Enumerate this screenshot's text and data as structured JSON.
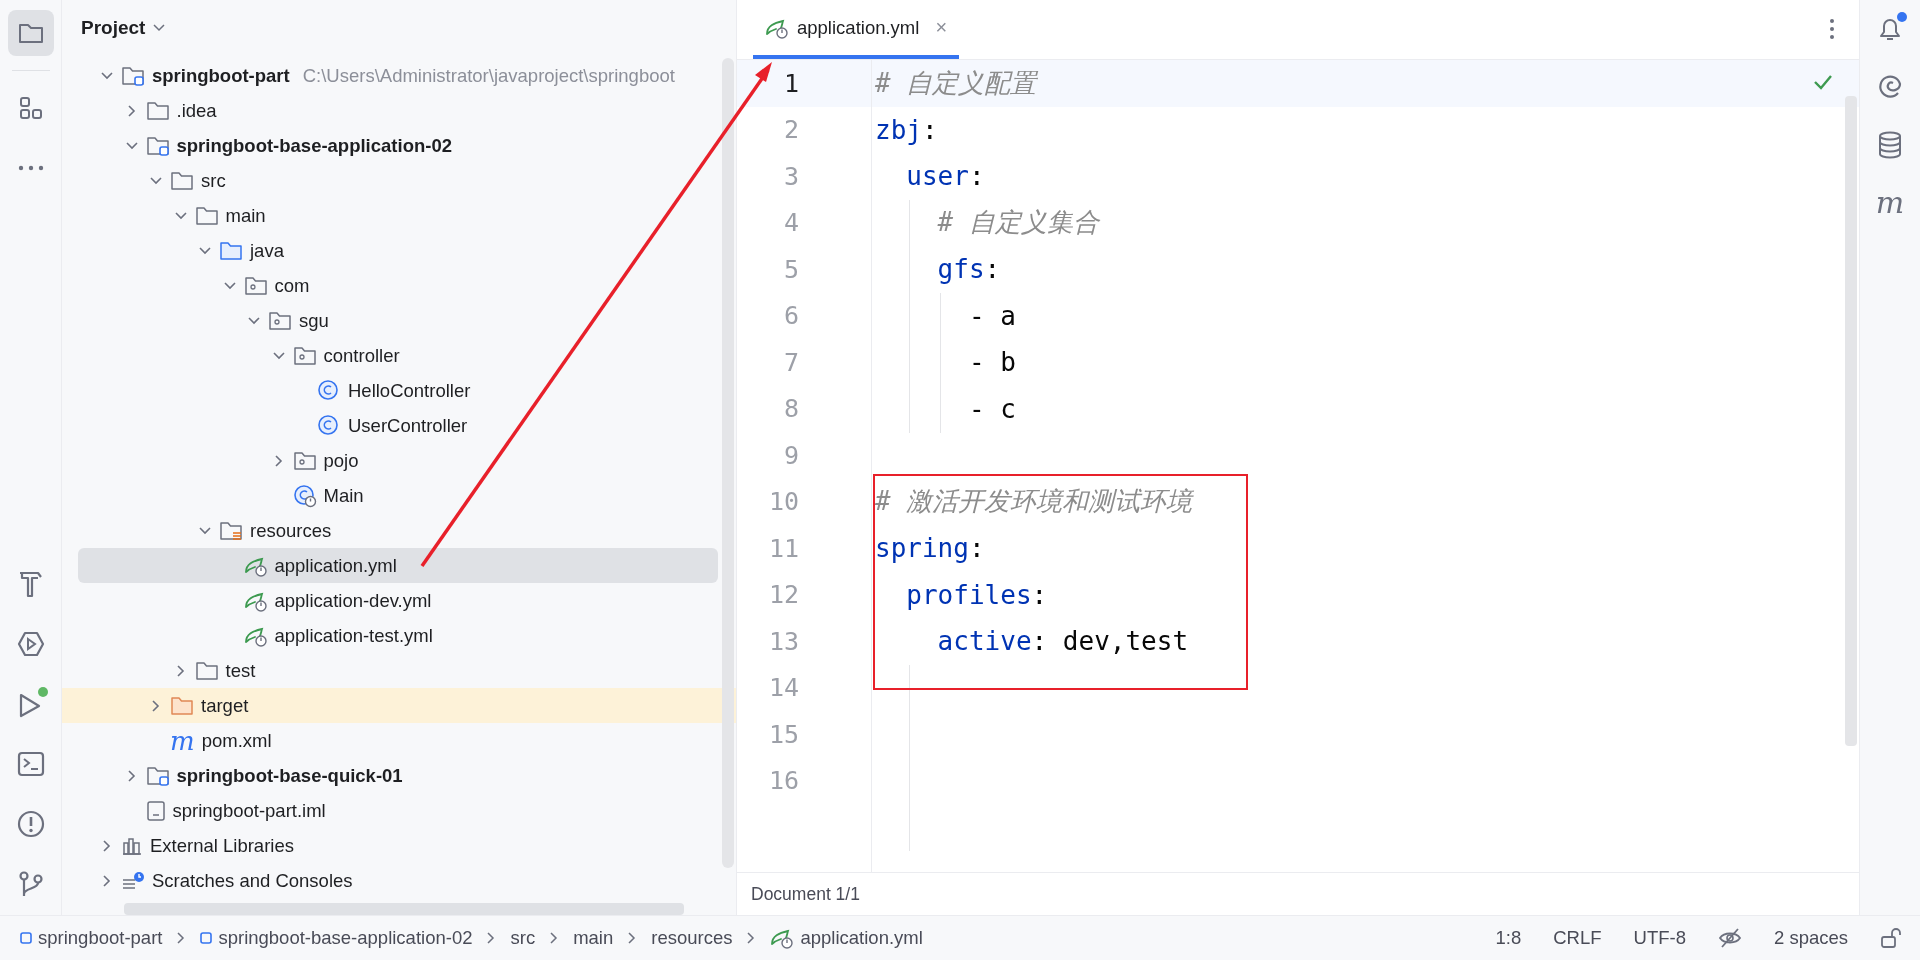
{
  "left_toolbar": {
    "top": [
      {
        "kind": "project",
        "selected": true
      },
      {
        "kind": "structure",
        "selected": false
      },
      {
        "kind": "more",
        "selected": false
      }
    ],
    "bottom": [
      {
        "kind": "build",
        "badge": false
      },
      {
        "kind": "services",
        "badge": false
      },
      {
        "kind": "run",
        "badge": true
      },
      {
        "kind": "terminal",
        "badge": false
      },
      {
        "kind": "problems",
        "badge": false
      },
      {
        "kind": "git",
        "badge": false
      }
    ]
  },
  "project": {
    "title": "Project",
    "tree": [
      {
        "name": "springboot-part",
        "kind": "module",
        "path": "C:\\Users\\Administrator\\javaproject\\springboot",
        "expanded": true,
        "selected": false,
        "children": [
          {
            "name": ".idea",
            "kind": "folder",
            "expanded": false,
            "selected": false
          },
          {
            "name": "springboot-base-application-02",
            "kind": "module",
            "expanded": true,
            "selected": false,
            "children": [
              {
                "name": "src",
                "kind": "folder",
                "expanded": true,
                "selected": false,
                "children": [
                  {
                    "name": "main",
                    "kind": "folder",
                    "expanded": true,
                    "selected": false,
                    "children": [
                      {
                        "name": "java",
                        "kind": "source-folder",
                        "expanded": true,
                        "selected": false,
                        "children": [
                          {
                            "name": "com",
                            "kind": "package",
                            "expanded": true,
                            "selected": false,
                            "children": [
                              {
                                "name": "sgu",
                                "kind": "package",
                                "expanded": true,
                                "selected": false,
                                "children": [
                                  {
                                    "name": "controller",
                                    "kind": "package",
                                    "expanded": true,
                                    "selected": false,
                                    "children": [
                                      {
                                        "name": "HelloController",
                                        "kind": "class",
                                        "selected": false
                                      },
                                      {
                                        "name": "UserController",
                                        "kind": "class",
                                        "selected": false
                                      }
                                    ]
                                  },
                                  {
                                    "name": "pojo",
                                    "kind": "package",
                                    "expanded": false,
                                    "selected": false
                                  },
                                  {
                                    "name": "Main",
                                    "kind": "main-class",
                                    "selected": false
                                  }
                                ]
                              }
                            ]
                          }
                        ]
                      },
                      {
                        "name": "resources",
                        "kind": "resource-folder",
                        "expanded": true,
                        "selected": false,
                        "children": [
                          {
                            "name": "application.yml",
                            "kind": "yml",
                            "selected": true
                          },
                          {
                            "name": "application-dev.yml",
                            "kind": "yml",
                            "selected": false
                          },
                          {
                            "name": "application-test.yml",
                            "kind": "yml",
                            "selected": false
                          }
                        ]
                      }
                    ]
                  },
                  {
                    "name": "test",
                    "kind": "folder",
                    "expanded": false,
                    "selected": false
                  }
                ]
              },
              {
                "name": "target",
                "kind": "excluded-folder",
                "expanded": false,
                "selected": false
              },
              {
                "name": "pom.xml",
                "kind": "maven",
                "glyph": "m",
                "selected": false
              }
            ]
          },
          {
            "name": "springboot-base-quick-01",
            "kind": "module",
            "expanded": false,
            "selected": false
          },
          {
            "name": "springboot-part.iml",
            "kind": "iml",
            "selected": false
          }
        ]
      },
      {
        "name": "External Libraries",
        "kind": "libraries",
        "expanded": false,
        "selected": false
      },
      {
        "name": "Scratches and Consoles",
        "kind": "scratches",
        "expanded": false,
        "selected": false
      }
    ]
  },
  "editor": {
    "tabs": [
      {
        "label": "application.yml",
        "close": "×",
        "selected": true
      }
    ],
    "lines": [
      {
        "number": "1",
        "current": true,
        "tokens": [
          {
            "kind": "comment",
            "text": "# 自定义配置"
          }
        ]
      },
      {
        "number": "2",
        "current": false,
        "tokens": [
          {
            "kind": "key",
            "text": "zbj"
          },
          {
            "kind": "plain",
            "text": ":"
          }
        ]
      },
      {
        "number": "3",
        "current": false,
        "tokens": [
          {
            "kind": "key",
            "text": "  user"
          },
          {
            "kind": "plain",
            "text": ":"
          }
        ]
      },
      {
        "number": "4",
        "current": false,
        "tokens": [
          {
            "kind": "comment",
            "text": "    # 自定义集合"
          }
        ]
      },
      {
        "number": "5",
        "current": false,
        "tokens": [
          {
            "kind": "key",
            "text": "    gfs"
          },
          {
            "kind": "plain",
            "text": ":"
          }
        ]
      },
      {
        "number": "6",
        "current": false,
        "tokens": [
          {
            "kind": "plain",
            "text": "      - a"
          }
        ]
      },
      {
        "number": "7",
        "current": false,
        "tokens": [
          {
            "kind": "plain",
            "text": "      - b"
          }
        ]
      },
      {
        "number": "8",
        "current": false,
        "tokens": [
          {
            "kind": "plain",
            "text": "      - c"
          }
        ]
      },
      {
        "number": "9",
        "current": false
      },
      {
        "number": "10",
        "current": false,
        "tokens": [
          {
            "kind": "comment",
            "text": "# 激活开发环境和测试环境"
          }
        ]
      },
      {
        "number": "11",
        "current": false,
        "tokens": [
          {
            "kind": "key",
            "text": "spring"
          },
          {
            "kind": "plain",
            "text": ":"
          }
        ]
      },
      {
        "number": "12",
        "current": false,
        "tokens": [
          {
            "kind": "key",
            "text": "  profiles"
          },
          {
            "kind": "plain",
            "text": ":"
          }
        ]
      },
      {
        "number": "13",
        "current": false,
        "tokens": [
          {
            "kind": "key",
            "text": "    active"
          },
          {
            "kind": "plain",
            "text": ": dev,test"
          }
        ]
      },
      {
        "number": "14",
        "current": false
      },
      {
        "number": "15",
        "current": false
      },
      {
        "number": "16",
        "current": false
      }
    ],
    "footer": "Document 1/1"
  },
  "right_toolbar": [
    {
      "kind": "notifications",
      "badge": true
    },
    {
      "kind": "ai",
      "badge": false
    },
    {
      "kind": "database",
      "badge": false
    },
    {
      "kind": "maven",
      "glyph": "m",
      "badge": false
    }
  ],
  "status_bar": {
    "breadcrumbs": [
      {
        "label": "springboot-part",
        "kind": "module"
      },
      {
        "label": "springboot-base-application-02",
        "kind": "module"
      },
      {
        "label": "src",
        "kind": "folder"
      },
      {
        "label": "main",
        "kind": "folder"
      },
      {
        "label": "resources",
        "kind": "folder"
      },
      {
        "label": "application.yml",
        "kind": "yml"
      }
    ],
    "items": [
      {
        "kind": "text",
        "text": "1:8"
      },
      {
        "kind": "text",
        "text": "CRLF"
      },
      {
        "kind": "text",
        "text": "UTF-8"
      },
      {
        "kind": "inspection"
      },
      {
        "kind": "text",
        "text": "2 spaces"
      },
      {
        "kind": "lock"
      }
    ]
  }
}
